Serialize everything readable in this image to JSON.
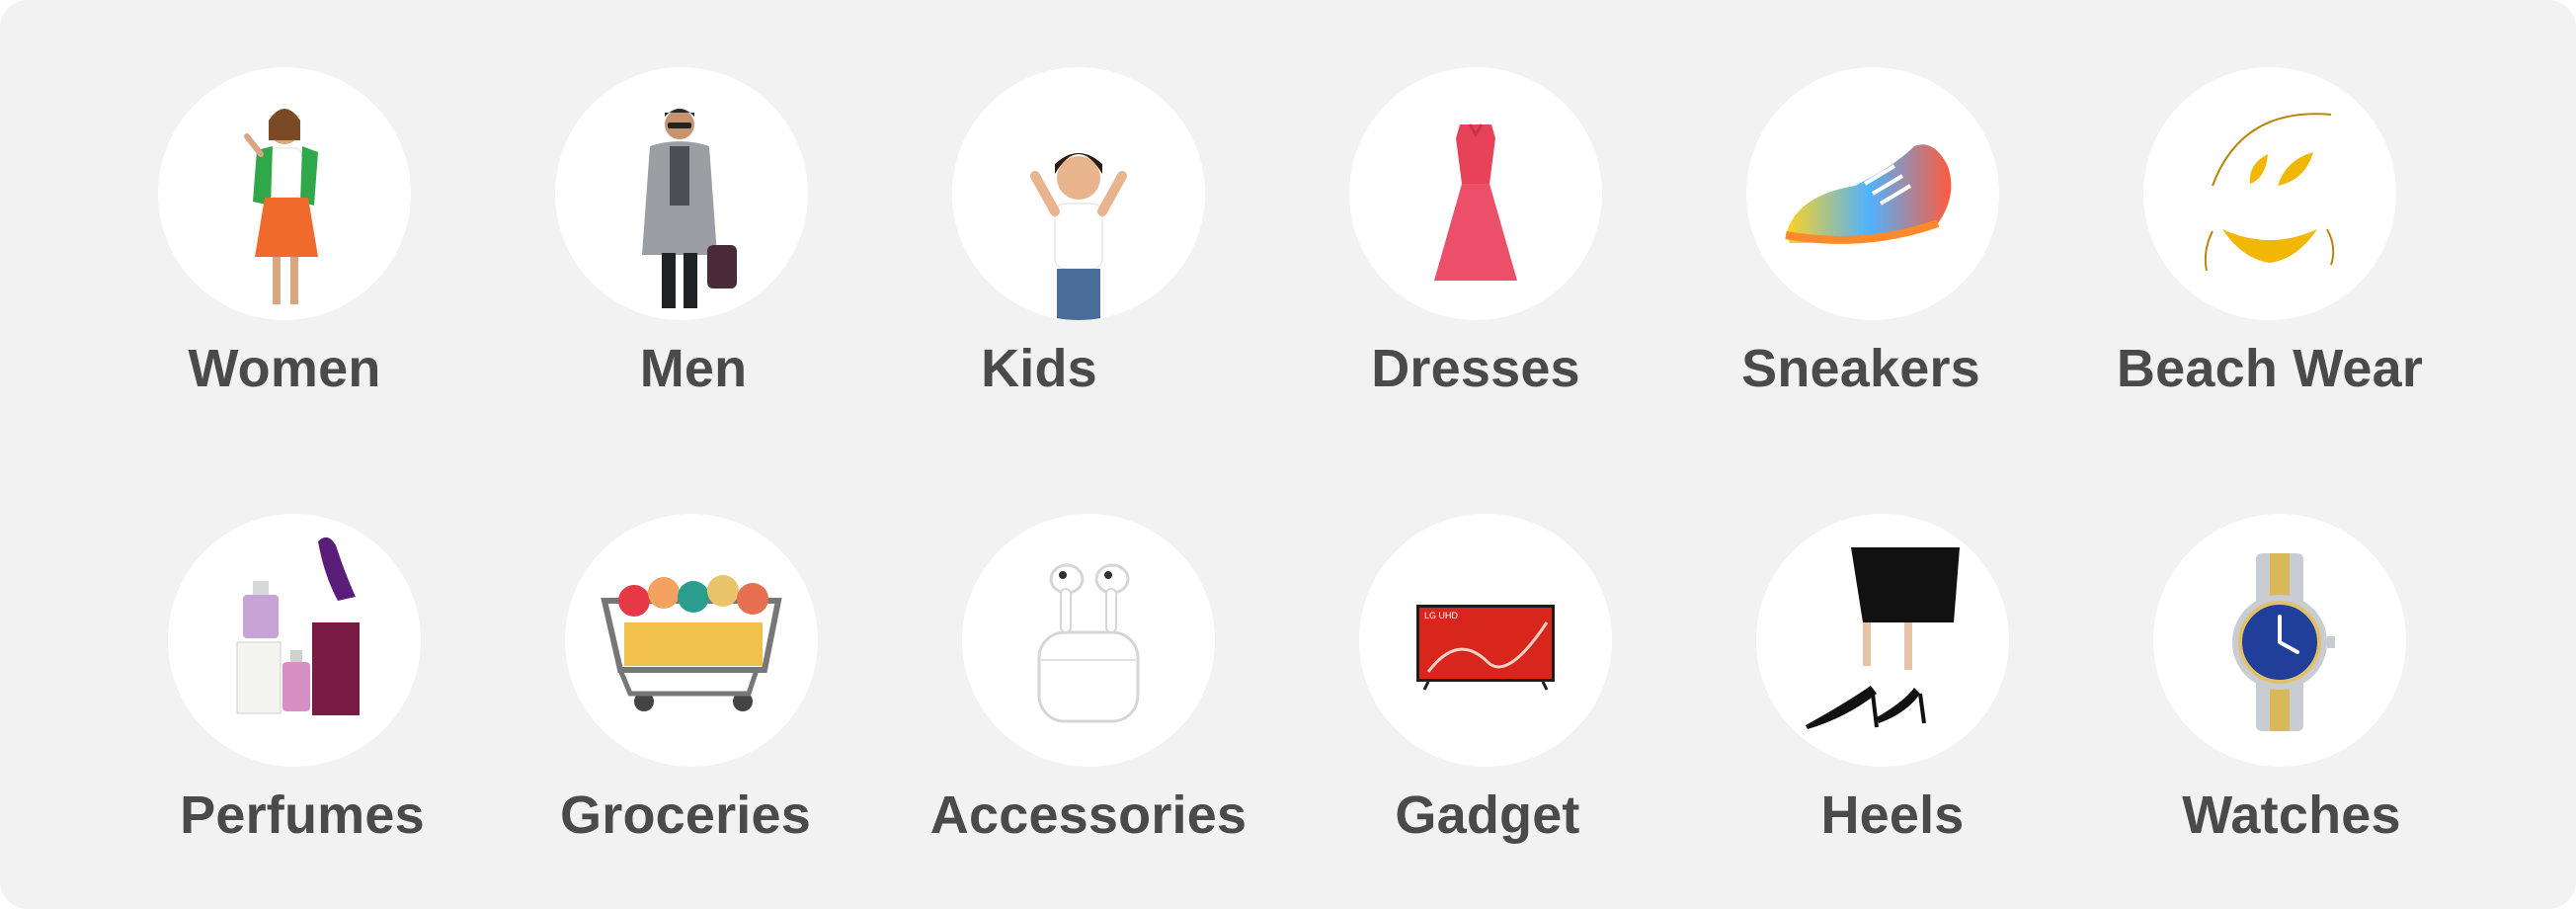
{
  "categories": {
    "row1": [
      {
        "label": "Women",
        "icon": "woman-figure-icon"
      },
      {
        "label": "Men",
        "icon": "man-figure-icon"
      },
      {
        "label": "Kids",
        "icon": "kid-figure-icon"
      },
      {
        "label": "Dresses",
        "icon": "dress-icon"
      },
      {
        "label": "Sneakers",
        "icon": "sneaker-icon"
      },
      {
        "label": "Beach Wear",
        "icon": "bikini-icon"
      }
    ],
    "row2": [
      {
        "label": "Perfumes",
        "icon": "perfume-icon"
      },
      {
        "label": "Groceries",
        "icon": "shopping-cart-icon"
      },
      {
        "label": "Accessories",
        "icon": "earbuds-icon"
      },
      {
        "label": "Gadget",
        "icon": "television-icon"
      },
      {
        "label": "Heels",
        "icon": "heels-icon"
      },
      {
        "label": "Watches",
        "icon": "wristwatch-icon"
      }
    ]
  },
  "colors": {
    "panel_bg": "#f2f2f2",
    "circle_bg": "#ffffff",
    "label_text": "#4a4a4a"
  }
}
